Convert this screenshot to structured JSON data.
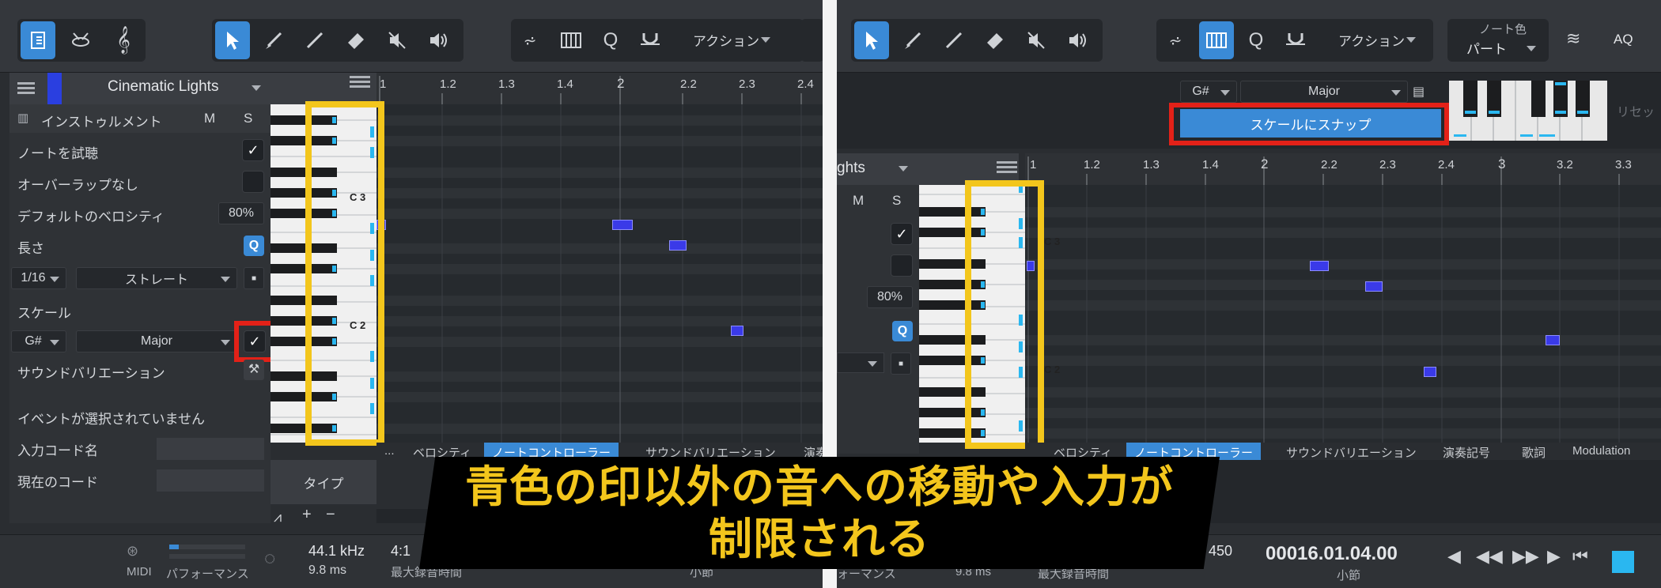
{
  "left": {
    "toolbar": {
      "action_label": "アクション"
    },
    "track": {
      "name": "Cinematic Lights"
    },
    "inspector": {
      "instrument_label": "インストゥルメント",
      "mute": "M",
      "solo": "S",
      "audition_notes": "ノートを試聴",
      "no_overlap": "オーバーラップなし",
      "default_velocity_label": "デフォルトのベロシティ",
      "default_velocity_value": "80%",
      "length_label": "長さ",
      "quantize_icon": "Q",
      "length_value": "1/16",
      "length_mode": "ストレート",
      "scale_label": "スケール",
      "scale_root": "G#",
      "scale_type": "Major",
      "sound_variation_label": "サウンドバリエーション",
      "no_event_selected": "イベントが選択されていません",
      "input_chord_label": "入力コード名",
      "current_chord_label": "現在のコード"
    },
    "ruler": [
      "1",
      "1.2",
      "1.3",
      "1.4",
      "2",
      "2.2",
      "2.3",
      "2.4"
    ],
    "keys": {
      "c3": "C 3",
      "c2": "C 2"
    },
    "tabs": [
      "...",
      "ベロシティ",
      "ノートコントローラー",
      "サウンドバリエーション",
      "演奏"
    ],
    "type_label": "タイプ",
    "transport": {
      "midi_label": "MIDI",
      "performance_label": "パフォーマンス",
      "sample_rate": "44.1 kHz",
      "latency": "9.8 ms",
      "time_partial": "4:1",
      "max_rec_time": "最大録音時間",
      "bar_label": "小節"
    }
  },
  "right": {
    "toolbar": {
      "action_label": "アクション",
      "note_color_label": "ノート色",
      "note_color_value": "パート",
      "aq_label": "AQ"
    },
    "scale": {
      "root": "G#",
      "type": "Major",
      "snap_button": "スケールにスナップ",
      "reset_label": "リセッ"
    },
    "track_name_partial": "ghts",
    "inspector": {
      "mute": "M",
      "solo": "S",
      "default_velocity_value": "80%",
      "quantize_icon": "Q"
    },
    "ruler": [
      "1",
      "1.2",
      "1.3",
      "1.4",
      "2",
      "2.2",
      "2.3",
      "2.4",
      "3",
      "3.2",
      "3.3"
    ],
    "keys": {
      "c3": "C 3",
      "c2": "C 2"
    },
    "tabs": [
      "ベロシティ",
      "ノートコントローラー",
      "サウンドバリエーション",
      "演奏記号",
      "歌詞",
      "Modulation"
    ],
    "transport": {
      "tempo_partial": "450",
      "position": "00016.01.04.00",
      "bar_label": "小節",
      "performance_partial": "ォーマンス",
      "latency_partial": "9.8 ms",
      "max_rec_time": "最大録音時間"
    }
  },
  "caption": {
    "line1": "青色の印以外の音への移動や入力が",
    "line2": "制限される"
  },
  "colors": {
    "accent_blue": "#3a8ad6",
    "highlight_yellow": "#f3c61c",
    "highlight_red": "#e32118",
    "note_blue": "#3a3ae8"
  }
}
